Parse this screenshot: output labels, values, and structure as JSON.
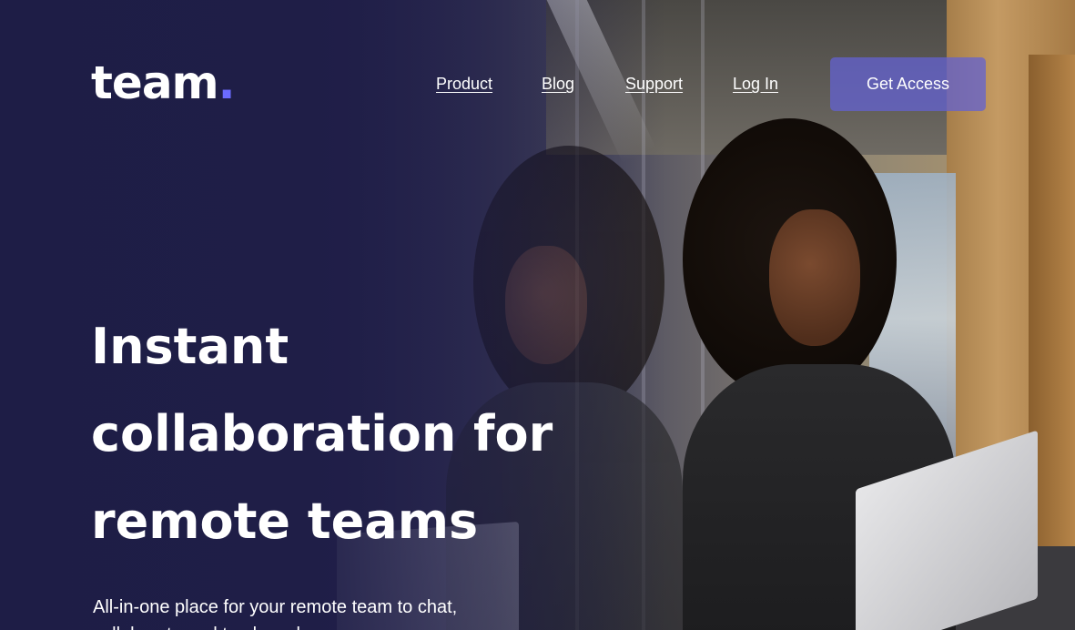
{
  "logo": {
    "text": "team",
    "dot": "."
  },
  "nav": {
    "items": [
      {
        "label": "Product"
      },
      {
        "label": "Blog"
      },
      {
        "label": "Support"
      },
      {
        "label": "Log In"
      }
    ],
    "cta_label": "Get Access"
  },
  "hero": {
    "headline_lines": [
      "Instant",
      "collaboration for",
      "remote teams"
    ],
    "subtext": "All-in-one place for your remote team to chat, collaborate and track work."
  },
  "colors": {
    "background": "#1e1d45",
    "accent": "#6b6bff",
    "cta_bg": "#6362d2",
    "text": "#ffffff"
  }
}
